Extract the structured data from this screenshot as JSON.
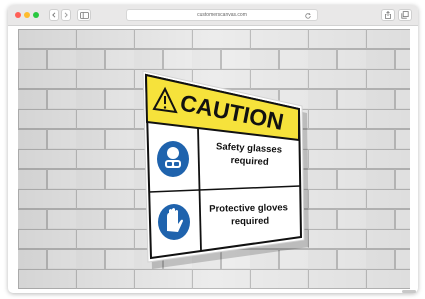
{
  "browser": {
    "url": "customerscanvas.com"
  },
  "sign": {
    "header": "CAUTION",
    "rows": [
      {
        "icon": "safety-glasses-icon",
        "line1": "Safety glasses",
        "line2": "required"
      },
      {
        "icon": "protective-gloves-icon",
        "line1": "Protective gloves",
        "line2": "required"
      }
    ]
  },
  "colors": {
    "caution_yellow": "#f6e23b",
    "mandatory_blue": "#1f63ad",
    "brick_wall": "#e4e4e4"
  }
}
